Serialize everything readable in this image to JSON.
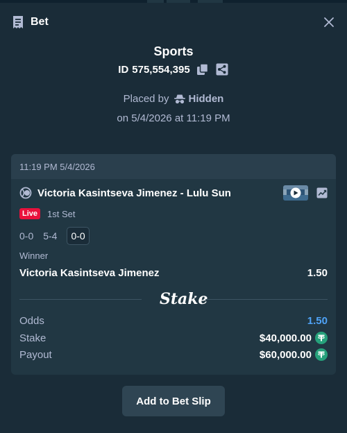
{
  "header": {
    "title": "Bet"
  },
  "bet": {
    "sport": "Sports",
    "id_label": "ID",
    "id_value": "575,554,395",
    "placed_by_label": "Placed by",
    "placed_by_user": "Hidden",
    "date_text": "on 5/4/2026 at 11:19 PM"
  },
  "card": {
    "timestamp": "11:19 PM 5/4/2026",
    "event_name": "Victoria Kasintseva Jimenez - Lulu Sun",
    "live_label": "Live",
    "set_label": "1st Set",
    "scores": [
      "0-0",
      "5-4",
      "0-0"
    ],
    "market": "Winner",
    "selection": "Victoria Kasintseva Jimenez",
    "selection_odds": "1.50",
    "brand": "Stake",
    "odds_label": "Odds",
    "odds_value": "1.50",
    "stake_label": "Stake",
    "stake_value": "$40,000.00",
    "payout_label": "Payout",
    "payout_value": "$60,000.00"
  },
  "actions": {
    "add_to_slip": "Add to Bet Slip"
  },
  "colors": {
    "background": "#1a2c38",
    "card": "#213743",
    "live": "#e9113c",
    "odds": "#4fa3f7",
    "tether": "#26a17b"
  },
  "icons": {
    "header": "bet-slip-icon",
    "close": "close-icon",
    "copy": "copy-icon",
    "share": "share-icon",
    "hidden_user": "incognito-icon",
    "sport": "tennis-ball-icon",
    "stream": "video-stream-icon",
    "stats": "stats-chart-icon",
    "currency": "tether-icon"
  }
}
